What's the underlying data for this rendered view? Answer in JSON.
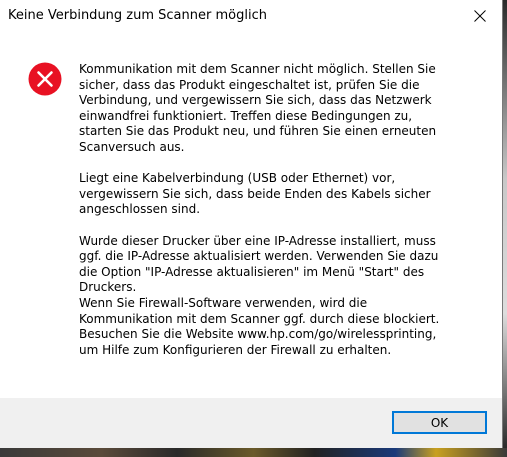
{
  "dialog": {
    "title": "Keine Verbindung zum Scanner möglich",
    "icon": "error-icon",
    "colors": {
      "error_red": "#e81123",
      "button_border": "#0078d7",
      "footer_bg": "#f0f0f0"
    },
    "paragraphs": [
      "Kommunikation mit dem Scanner nicht möglich. Stellen Sie\nsicher, dass das Produkt eingeschaltet ist, prüfen Sie die\nVerbindung, und vergewissern Sie sich, dass das Netzwerk\neinwandfrei funktioniert. Treffen diese Bedingungen zu,\nstarten Sie das Produkt neu, und führen Sie einen erneuten\nScanversuch aus.",
      "Liegt eine Kabelverbindung (USB oder Ethernet) vor,\nvergewissern Sie sich, dass beide Enden des Kabels sicher\nangeschlossen sind.",
      "Wurde dieser Drucker über eine IP-Adresse installiert, muss\nggf. die IP-Adresse aktualisiert werden. Verwenden Sie dazu\ndie Option \"IP-Adresse aktualisieren\" im Menü \"Start\" des\nDruckers.",
      "Wenn Sie Firewall-Software verwenden, wird die\nKommunikation mit dem Scanner ggf. durch diese blockiert.\nBesuchen Sie die Website www.hp.com/go/wirelessprinting,\num Hilfe zum Konfigurieren der Firewall zu erhalten."
    ],
    "ok_label": "OK"
  }
}
